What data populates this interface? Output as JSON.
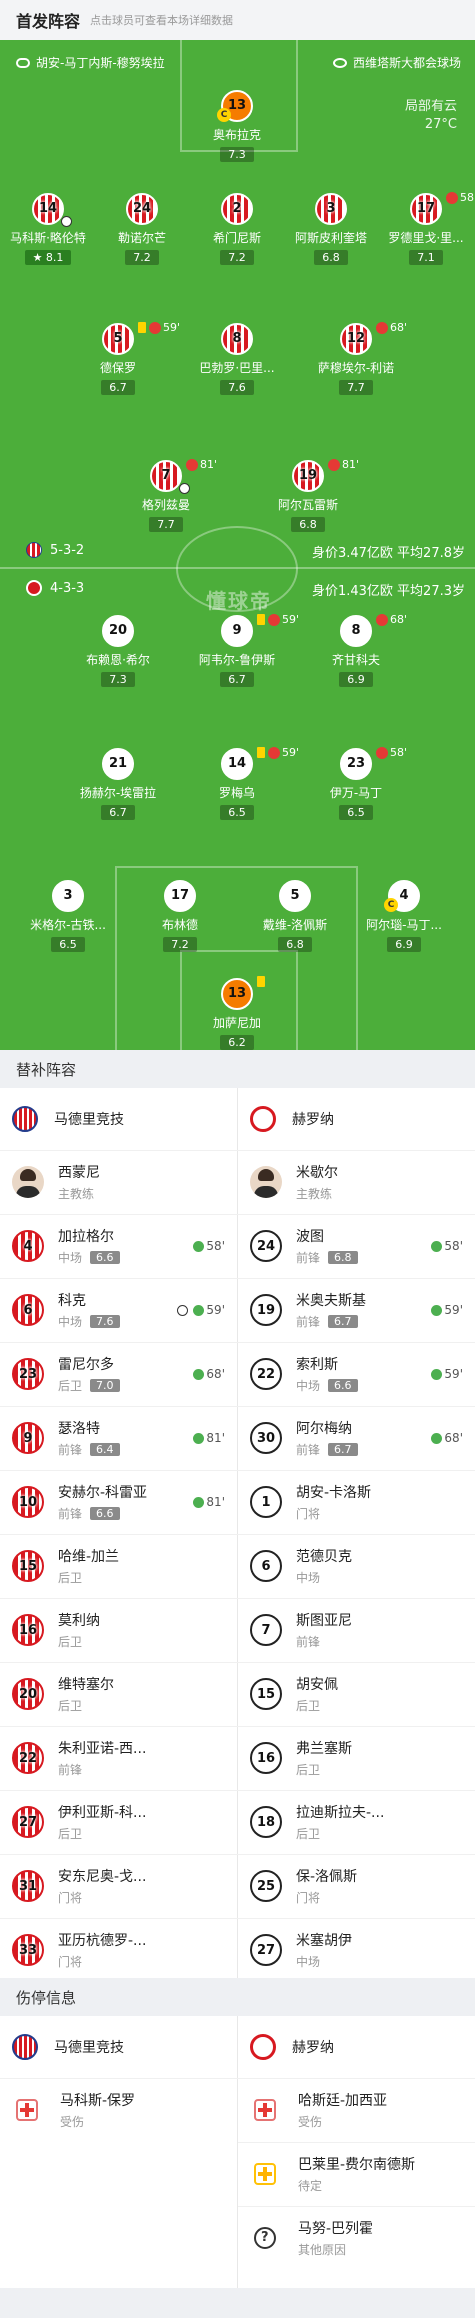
{
  "header": {
    "title": "首发阵容",
    "subtitle": "点击球员可查看本场详细数据"
  },
  "venue": {
    "referee": "胡安-马丁内斯-穆努埃拉",
    "stadium": "西维塔斯大都会球场"
  },
  "weather": {
    "condition": "局部有云",
    "temp": "27°C"
  },
  "colors": {
    "pitch": "#4cae3a",
    "atm_red": "#d71920",
    "sub_green": "#4caf50"
  },
  "watermark": "懂球帝",
  "home": {
    "formation": "5-3-2",
    "value": "身价3.47亿欧",
    "age": "平均27.8岁"
  },
  "away": {
    "formation": "4-3-3",
    "value": "身价1.43亿欧",
    "age": "平均27.3岁"
  },
  "home_players": [
    {
      "num": "13",
      "name": "奥布拉克",
      "rating": "7.3",
      "captain": "C"
    },
    {
      "num": "14",
      "name": "马科斯·略伦特",
      "rating": "8.1"
    },
    {
      "num": "24",
      "name": "勒诺尔芒",
      "rating": "7.2"
    },
    {
      "num": "2",
      "name": "希门尼斯",
      "rating": "7.2"
    },
    {
      "num": "3",
      "name": "阿斯皮利奎塔",
      "rating": "6.8"
    },
    {
      "num": "17",
      "name": "罗德里戈·里...",
      "rating": "7.1",
      "sub": "58'"
    },
    {
      "num": "5",
      "name": "德保罗",
      "rating": "6.7",
      "sub": "59'"
    },
    {
      "num": "8",
      "name": "巴勃罗·巴里...",
      "rating": "7.6"
    },
    {
      "num": "12",
      "name": "萨穆埃尔-利诺",
      "rating": "7.7",
      "sub": "68'"
    },
    {
      "num": "7",
      "name": "格列兹曼",
      "rating": "7.7",
      "sub": "81'"
    },
    {
      "num": "19",
      "name": "阿尔瓦雷斯",
      "rating": "6.8",
      "sub": "81'"
    }
  ],
  "away_players": [
    {
      "num": "20",
      "name": "布赖恩·希尔",
      "rating": "7.3"
    },
    {
      "num": "9",
      "name": "阿韦尔-鲁伊斯",
      "rating": "6.7",
      "sub": "59'"
    },
    {
      "num": "8",
      "name": "齐甘科夫",
      "rating": "6.9",
      "sub": "68'"
    },
    {
      "num": "21",
      "name": "扬赫尔-埃雷拉",
      "rating": "6.7"
    },
    {
      "num": "14",
      "name": "罗梅乌",
      "rating": "6.5",
      "sub": "59'"
    },
    {
      "num": "23",
      "name": "伊万-马丁",
      "rating": "6.5",
      "sub": "58'"
    },
    {
      "num": "3",
      "name": "米格尔-古铁...",
      "rating": "6.5"
    },
    {
      "num": "17",
      "name": "布林德",
      "rating": "7.2"
    },
    {
      "num": "5",
      "name": "戴维-洛佩斯",
      "rating": "6.8"
    },
    {
      "num": "4",
      "name": "阿尔瑙-马丁...",
      "rating": "6.9",
      "captain": "C"
    },
    {
      "num": "13",
      "name": "加萨尼加",
      "rating": "6.2"
    }
  ],
  "subs": {
    "title": "替补阵容",
    "home_team": "马德里竞技",
    "away_team": "赫罗纳",
    "home_coach": {
      "name": "西蒙尼",
      "role": "主教练"
    },
    "away_coach": {
      "name": "米歇尔",
      "role": "主教练"
    },
    "home": [
      {
        "num": "4",
        "name": "加拉格尔",
        "pos": "中场",
        "rating": "6.6",
        "min": "58'"
      },
      {
        "num": "6",
        "name": "科克",
        "pos": "中场",
        "rating": "7.6",
        "min": "59'",
        "goal": true
      },
      {
        "num": "23",
        "name": "雷尼尔多",
        "pos": "后卫",
        "rating": "7.0",
        "min": "68'"
      },
      {
        "num": "9",
        "name": "瑟洛特",
        "pos": "前锋",
        "rating": "6.4",
        "min": "81'"
      },
      {
        "num": "10",
        "name": "安赫尔-科雷亚",
        "pos": "前锋",
        "rating": "6.6",
        "min": "81'"
      },
      {
        "num": "15",
        "name": "哈维-加兰",
        "pos": "后卫"
      },
      {
        "num": "16",
        "name": "莫利纳",
        "pos": "后卫"
      },
      {
        "num": "20",
        "name": "维特塞尔",
        "pos": "后卫"
      },
      {
        "num": "22",
        "name": "朱利亚诺-西...",
        "pos": "前锋"
      },
      {
        "num": "27",
        "name": "伊利亚斯-科...",
        "pos": "后卫"
      },
      {
        "num": "31",
        "name": "安东尼奥-戈...",
        "pos": "门将"
      },
      {
        "num": "33",
        "name": "亚历杭德罗-...",
        "pos": "门将"
      }
    ],
    "away": [
      {
        "num": "24",
        "name": "波图",
        "pos": "前锋",
        "rating": "6.8",
        "min": "58'"
      },
      {
        "num": "19",
        "name": "米奥夫斯基",
        "pos": "前锋",
        "rating": "6.7",
        "min": "59'"
      },
      {
        "num": "22",
        "name": "索利斯",
        "pos": "中场",
        "rating": "6.6",
        "min": "59'"
      },
      {
        "num": "30",
        "name": "阿尔梅纳",
        "pos": "前锋",
        "rating": "6.7",
        "min": "68'"
      },
      {
        "num": "1",
        "name": "胡安-卡洛斯",
        "pos": "门将"
      },
      {
        "num": "6",
        "name": "范德贝克",
        "pos": "中场"
      },
      {
        "num": "7",
        "name": "斯图亚尼",
        "pos": "前锋"
      },
      {
        "num": "15",
        "name": "胡安佩",
        "pos": "后卫"
      },
      {
        "num": "16",
        "name": "弗兰塞斯",
        "pos": "后卫"
      },
      {
        "num": "18",
        "name": "拉迪斯拉夫-...",
        "pos": "后卫"
      },
      {
        "num": "25",
        "name": "保-洛佩斯",
        "pos": "门将"
      },
      {
        "num": "27",
        "name": "米塞胡伊",
        "pos": "中场"
      }
    ]
  },
  "injuries": {
    "title": "伤停信息",
    "home_team": "马德里竞技",
    "away_team": "赫罗纳",
    "home": [
      {
        "name": "马科斯-保罗",
        "status": "受伤",
        "icon": "red-cross-icon"
      }
    ],
    "away": [
      {
        "name": "哈斯廷-加西亚",
        "status": "受伤",
        "icon": "red-cross-icon"
      },
      {
        "name": "巴莱里-费尔南德斯",
        "status": "待定",
        "icon": "yellow-cross-icon"
      },
      {
        "name": "马努-巴列霍",
        "status": "其他原因",
        "icon": "question-icon",
        "q": "?"
      }
    ]
  }
}
